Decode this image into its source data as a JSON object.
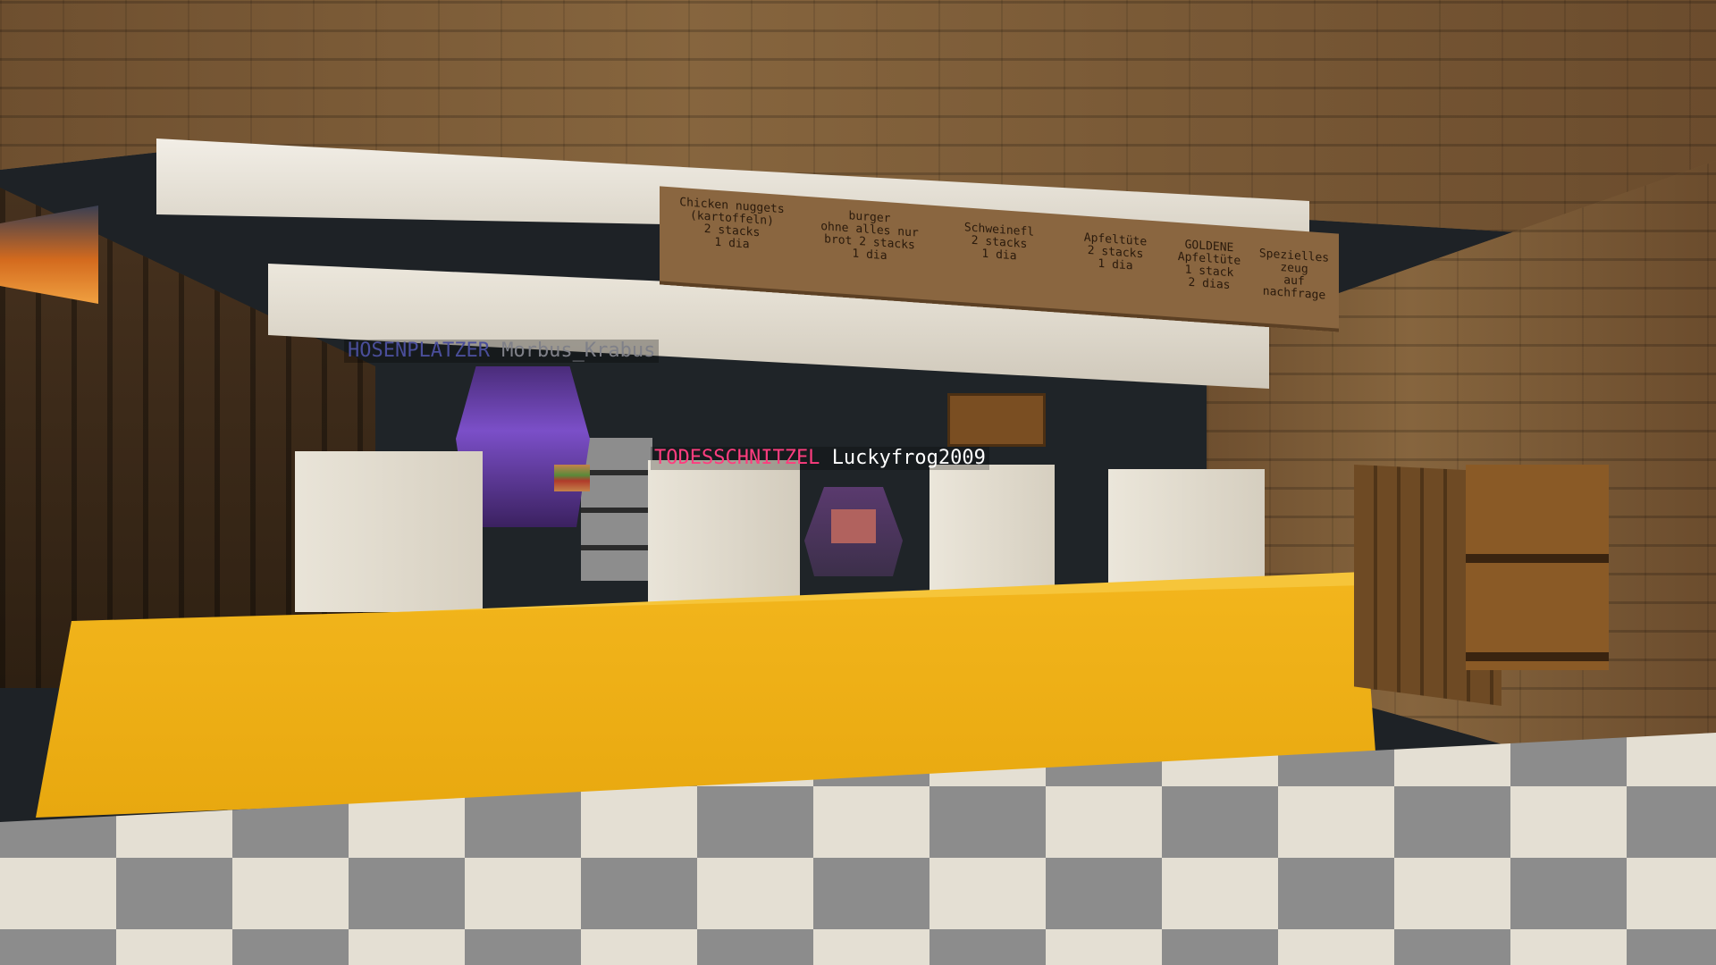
{
  "menu_sign": {
    "items": [
      {
        "text": "Chicken nuggets\n(kartoffeln)\n2 stacks\n1 dia"
      },
      {
        "text": "burger\nohne alles nur\nbrot 2 stacks\n1 dia"
      },
      {
        "text": "Schweinefl\n2 stacks\n1 dia"
      },
      {
        "text": "Apfeltüte\n2 stacks\n1 dia"
      },
      {
        "text": "GOLDENE\nApfeltüte\n1 stack\n2 dias"
      },
      {
        "text": "Spezielles\nzeug\nauf nachfrage"
      }
    ]
  },
  "players": [
    {
      "team_prefix": "HOSENPLATZER",
      "name": "Morbus_Krabus",
      "prefix_color": "#5a5a9a",
      "name_color": "#9a9aa0"
    },
    {
      "team_prefix": "TODESSCHNITZEL",
      "name": "Luckyfrog2009",
      "prefix_color": "#ff3d7f",
      "name_color": "#ffffff"
    }
  ],
  "colors": {
    "counter": "#f2b51c",
    "quartz": "#e6e1d6",
    "wall": "#1f2428",
    "sign": "#8a6640"
  }
}
